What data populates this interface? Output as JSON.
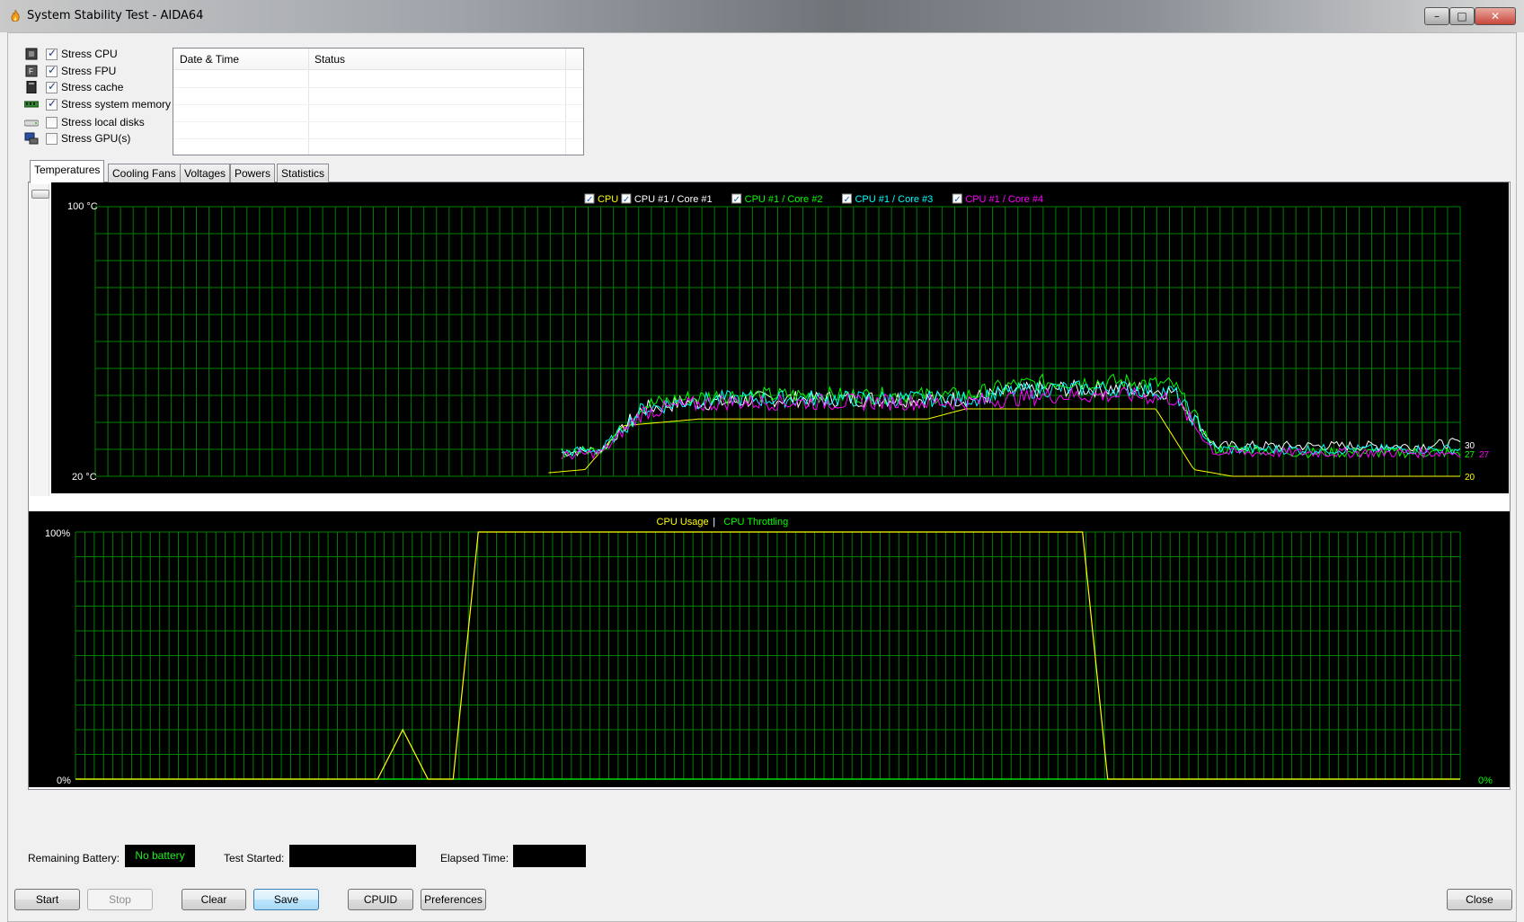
{
  "window": {
    "title": "System Stability Test - AIDA64",
    "app_icon": "flame-icon",
    "min_glyph": "–",
    "max_glyph": "□",
    "close_glyph": "✕"
  },
  "stress_options": [
    {
      "label": "Stress CPU",
      "checked": true,
      "icon": "cpu-icon"
    },
    {
      "label": "Stress FPU",
      "checked": true,
      "icon": "fpu-icon"
    },
    {
      "label": "Stress cache",
      "checked": true,
      "icon": "cache-icon"
    },
    {
      "label": "Stress system memory",
      "checked": true,
      "icon": "memory-icon"
    },
    {
      "label": "Stress local disks",
      "checked": false,
      "icon": "disk-icon"
    },
    {
      "label": "Stress GPU(s)",
      "checked": false,
      "icon": "gpu-icon"
    }
  ],
  "log_table": {
    "columns": [
      "Date & Time",
      "Status"
    ],
    "rows": []
  },
  "tabs": [
    "Temperatures",
    "Cooling Fans",
    "Voltages",
    "Powers",
    "Statistics"
  ],
  "active_tab": "Temperatures",
  "temperature_chart": {
    "legend": [
      {
        "label": "CPU",
        "color": "#ffff00"
      },
      {
        "label": "CPU #1 / Core #1",
        "color": "#ffffff"
      },
      {
        "label": "CPU #1 / Core #2",
        "color": "#00ff00"
      },
      {
        "label": "CPU #1 / Core #3",
        "color": "#00ffff"
      },
      {
        "label": "CPU #1 / Core #4",
        "color": "#ff00ff"
      }
    ],
    "y_max_label": "100 °C",
    "y_min_label": "20 °C",
    "end_labels": [
      {
        "text": "30",
        "color": "#ffffff"
      },
      {
        "text": "27",
        "color": "#00ff00"
      },
      {
        "text": "27",
        "color": "#ff00ff"
      },
      {
        "text": "20",
        "color": "#ffff00"
      }
    ]
  },
  "usage_chart": {
    "legend": [
      {
        "label": "CPU Usage",
        "color": "#ffff00"
      },
      {
        "label": "CPU Throttling",
        "color": "#00ff00"
      }
    ],
    "legend_sep": "|",
    "y_max_label": "100%",
    "y_min_label": "0%",
    "end_label": "0%"
  },
  "status": {
    "battery_label": "Remaining Battery:",
    "battery_value": "No battery",
    "test_started_label": "Test Started:",
    "test_started_value": "",
    "elapsed_label": "Elapsed Time:",
    "elapsed_value": ""
  },
  "buttons": {
    "start": "Start",
    "stop": "Stop",
    "clear": "Clear",
    "save": "Save",
    "cpuid": "CPUID",
    "preferences": "Preferences",
    "close": "Close"
  },
  "colors": {
    "grid": "#008000",
    "chart_bg": "#000000"
  },
  "chart_data": [
    {
      "type": "line",
      "title": "",
      "ylim": [
        20,
        100
      ],
      "x": [
        0,
        5,
        10,
        15,
        20,
        25,
        30,
        35,
        40,
        45,
        50,
        55,
        60,
        65,
        70,
        75,
        80,
        85,
        90,
        95,
        100
      ],
      "series": [
        {
          "name": "CPU",
          "values": [
            null,
            null,
            null,
            null,
            null,
            21,
            22,
            35,
            36,
            37,
            37,
            37,
            37,
            37,
            37,
            37,
            40,
            40,
            40,
            40,
            40,
            40,
            22,
            20,
            20,
            20,
            20,
            20,
            20,
            20
          ]
        },
        {
          "name": "CPU #1 / Core #1",
          "values": [
            null,
            null,
            null,
            null,
            null,
            27,
            28,
            40,
            42,
            42,
            43,
            43,
            43,
            43,
            43,
            43,
            45,
            46,
            46,
            46,
            45,
            29,
            29,
            29,
            29,
            29,
            29,
            30
          ]
        },
        {
          "name": "CPU #1 / Core #2",
          "values": [
            null,
            null,
            null,
            null,
            null,
            27,
            28,
            41,
            43,
            44,
            44,
            44,
            44,
            44,
            44,
            44,
            47,
            48,
            48,
            48,
            47,
            28,
            28,
            27,
            27,
            27,
            27,
            27
          ]
        },
        {
          "name": "CPU #1 / Core #3",
          "values": [
            null,
            null,
            null,
            null,
            null,
            27,
            28,
            40,
            42,
            43,
            43,
            43,
            43,
            43,
            43,
            43,
            45,
            46,
            46,
            46,
            45,
            28,
            28,
            28,
            28,
            28,
            28,
            28
          ]
        },
        {
          "name": "CPU #1 / Core #4",
          "values": [
            null,
            null,
            null,
            null,
            null,
            26,
            27,
            39,
            41,
            42,
            42,
            42,
            42,
            42,
            42,
            42,
            43,
            44,
            44,
            44,
            43,
            27,
            27,
            27,
            27,
            27,
            27,
            27
          ]
        }
      ]
    },
    {
      "type": "line",
      "title": "",
      "ylim": [
        0,
        100
      ],
      "series": [
        {
          "name": "CPU Usage",
          "values": [
            0,
            0,
            0,
            0,
            0,
            0,
            0,
            0,
            0,
            0,
            0,
            0,
            0,
            20,
            0,
            0,
            100,
            100,
            100,
            100,
            100,
            100,
            100,
            100,
            100,
            100,
            100,
            100,
            100,
            100,
            100,
            100,
            100,
            100,
            100,
            100,
            100,
            100,
            100,
            100,
            100,
            0,
            0,
            0,
            0,
            0,
            0,
            0,
            0,
            0,
            0,
            0,
            0,
            0,
            0,
            0
          ]
        },
        {
          "name": "CPU Throttling",
          "values": [
            0,
            0,
            0,
            0,
            0,
            0,
            0,
            0,
            0,
            0,
            0,
            0,
            0,
            0,
            0,
            0,
            0,
            0,
            0,
            0,
            0,
            0,
            0,
            0,
            0,
            0,
            0,
            0,
            0,
            0,
            0,
            0,
            0,
            0,
            0,
            0,
            0,
            0,
            0,
            0,
            0,
            0,
            0,
            0,
            0,
            0,
            0,
            0,
            0,
            0,
            0,
            0,
            0,
            0,
            0,
            0
          ]
        }
      ]
    }
  ]
}
